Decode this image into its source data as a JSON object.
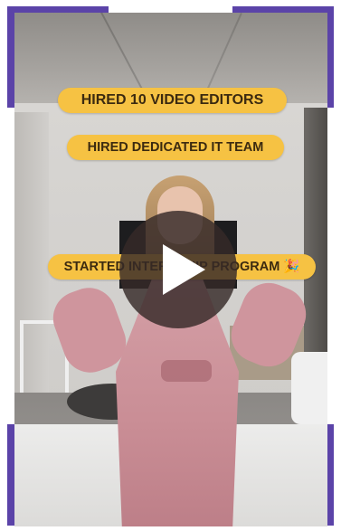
{
  "captions": [
    "HIRED 10 VIDEO EDITORS",
    "HIRED DEDICATED IT TEAM",
    "STARTED INTERNSHIP PROGRAM 🎉"
  ],
  "video": {
    "play_icon": "play-icon"
  },
  "colors": {
    "accent": "#5b43a8",
    "caption_bg": "#f6c243",
    "caption_text": "#3b2a10"
  }
}
